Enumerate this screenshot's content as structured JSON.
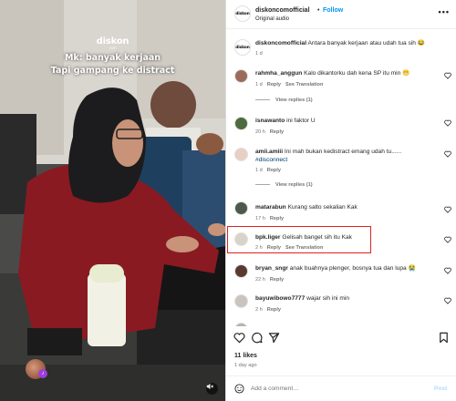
{
  "media": {
    "brand": "diskon",
    "brand_sub": "com",
    "overlay_line1": "Mk: banyak kerjaan",
    "overlay_line2": "Tapi gampang ke distract"
  },
  "header": {
    "username": "diskoncomofficial",
    "dot": "•",
    "follow": "Follow",
    "subtitle": "Original audio",
    "more": "•••"
  },
  "caption": {
    "username": "diskoncomofficial",
    "text": "Antara banyak kerjaan atau udah tua sih 😂",
    "time": "1 d"
  },
  "comments": [
    {
      "username": "rahmha_anggun",
      "text": "Kalo dikantorku dah kena SP itu min 😬",
      "time": "1 d",
      "reply": "Reply",
      "see_translation": "See Translation",
      "view_replies": "View replies (1)"
    },
    {
      "username": "isnawanto",
      "text": "ini faktor U",
      "time": "20 h",
      "reply": "Reply"
    },
    {
      "username": "amii.amiii",
      "text": "Ini mah bukan kedistract emang udah tu......",
      "hashtag": "#disconnect",
      "time": "1 d",
      "reply": "Reply",
      "view_replies": "View replies (1)"
    },
    {
      "username": "matarabun",
      "text": "Kurang salto sekalian Kak",
      "time": "17 h",
      "reply": "Reply"
    },
    {
      "username": "bpk.liger",
      "text": "Gelisah banget sih itu Kak",
      "time": "2 h",
      "reply": "Reply",
      "see_translation": "See Translation"
    },
    {
      "username": "bryan_sngr",
      "text": "anak buahnya plenger, bosnya tua dan lupa 😭",
      "time": "22 h",
      "reply": "Reply"
    },
    {
      "username": "bayuwibowo7777",
      "text": "wajar sih ini min",
      "time": "2 h",
      "reply": "Reply"
    }
  ],
  "footer": {
    "likes": "11 likes",
    "ago": "1 day ago",
    "add_placeholder": "Add a comment…",
    "post": "Post"
  },
  "colors": {
    "follow": "#0095f6",
    "highlight": "#e0221e",
    "meta": "#737373"
  },
  "icons": [
    "more-icon",
    "heart-icon",
    "comment-icon",
    "share-icon",
    "bookmark-icon",
    "emoji-icon",
    "mute-icon"
  ]
}
